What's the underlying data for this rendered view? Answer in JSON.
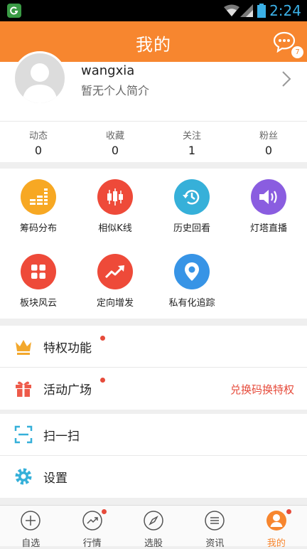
{
  "status_bar": {
    "time": "2:24"
  },
  "header": {
    "title": "我的",
    "message_badge": "7"
  },
  "profile": {
    "username": "wangxia",
    "bio": "暂无个人简介"
  },
  "stats": [
    {
      "label": "动态",
      "value": "0"
    },
    {
      "label": "收藏",
      "value": "0"
    },
    {
      "label": "关注",
      "value": "1"
    },
    {
      "label": "粉丝",
      "value": "0"
    }
  ],
  "tools": [
    {
      "label": "筹码分布",
      "icon": "chip-distribution-icon",
      "color": "#f7a823"
    },
    {
      "label": "相似K线",
      "icon": "candlestick-icon",
      "color": "#ee4a39"
    },
    {
      "label": "历史回看",
      "icon": "history-icon",
      "color": "#36b0d9"
    },
    {
      "label": "灯塔直播",
      "icon": "speaker-icon",
      "color": "#8a5de0"
    },
    {
      "label": "板块风云",
      "icon": "grid-blocks-icon",
      "color": "#ee4a39"
    },
    {
      "label": "定向增发",
      "icon": "trend-up-icon",
      "color": "#ee4a39"
    },
    {
      "label": "私有化追踪",
      "icon": "location-pin-icon",
      "color": "#3794e6"
    }
  ],
  "menu1": [
    {
      "label": "特权功能",
      "icon": "crown-icon",
      "has_dot": true,
      "right_text": ""
    },
    {
      "label": "活动广场",
      "icon": "gift-icon",
      "has_dot": true,
      "right_text": "兑换码换特权"
    }
  ],
  "menu2": [
    {
      "label": "扫一扫",
      "icon": "scan-icon"
    },
    {
      "label": "设置",
      "icon": "settings-gear-icon"
    }
  ],
  "tabbar": [
    {
      "label": "自选",
      "icon": "plus-circle-icon",
      "active": false,
      "has_dot": false
    },
    {
      "label": "行情",
      "icon": "trend-icon",
      "active": false,
      "has_dot": true
    },
    {
      "label": "选股",
      "icon": "compass-icon",
      "active": false,
      "has_dot": false
    },
    {
      "label": "资讯",
      "icon": "news-list-icon",
      "active": false,
      "has_dot": false
    },
    {
      "label": "我的",
      "icon": "profile-icon",
      "active": true,
      "has_dot": true
    }
  ],
  "colors": {
    "accent": "#f7862f",
    "red": "#e64b3b"
  }
}
